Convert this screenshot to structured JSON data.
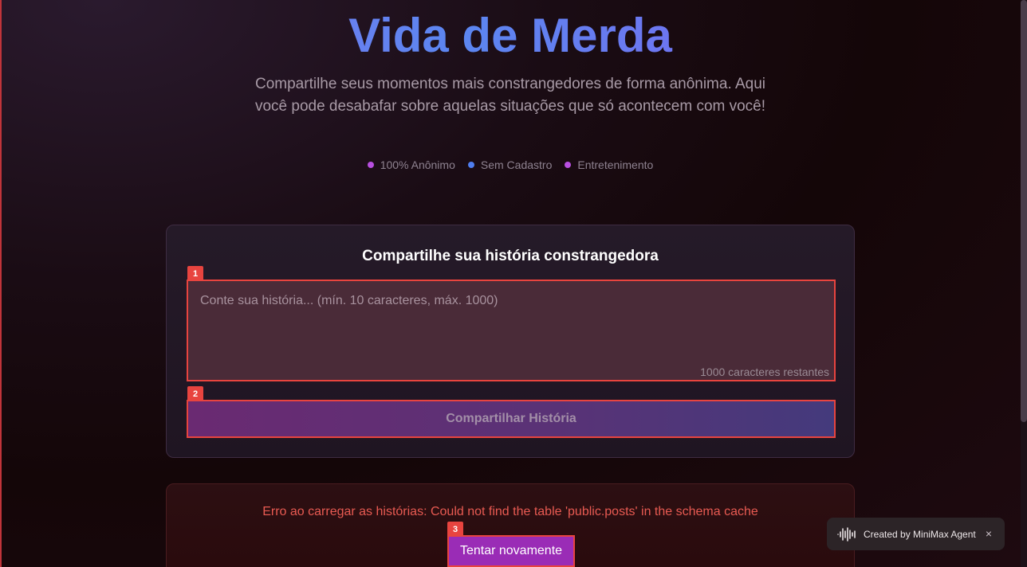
{
  "hero": {
    "title": "Vida de Merda",
    "subtitle": "Compartilhe seus momentos mais constrangedores de forma anônima. Aqui você pode desabafar sobre aquelas situações que só acontecem com você!",
    "features": [
      {
        "label": "100% Anônimo",
        "color": "#b84fe0"
      },
      {
        "label": "Sem Cadastro",
        "color": "#4f7ef0"
      },
      {
        "label": "Entretenimento",
        "color": "#b84fe0"
      }
    ]
  },
  "form": {
    "title": "Compartilhe sua história constrangedora",
    "placeholder": "Conte sua história... (mín. 10 caracteres, máx. 1000)",
    "value": "",
    "counter": "1000 caracteres restantes",
    "submit_label": "Compartilhar História"
  },
  "error": {
    "message": "Erro ao carregar as histórias: Could not find the table 'public.posts' in the schema cache",
    "retry_label": "Tentar novamente"
  },
  "badges": [
    "1",
    "2",
    "3"
  ],
  "toast": {
    "label": "Created by MiniMax Agent",
    "close": "×"
  },
  "colors": {
    "accent_red": "#e8443f",
    "purple": "#9a2cb6"
  }
}
